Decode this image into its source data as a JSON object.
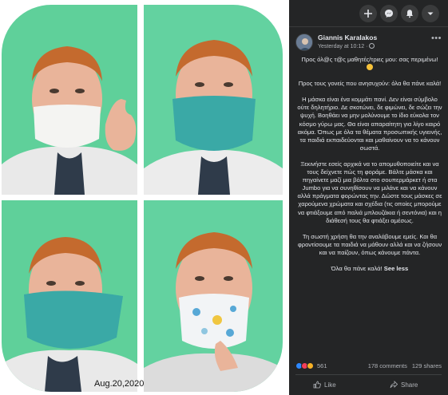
{
  "collage": {
    "date_stamp": "Aug.20,2020",
    "bg_green": "#6fd4a8",
    "mask_teal": "#3aa9a6",
    "mask_white": "#f4f4f2"
  },
  "topbar": {
    "icons": [
      "plus-icon",
      "messenger-icon",
      "bell-icon",
      "chevron-down-icon"
    ]
  },
  "post": {
    "author": "Giannis Karalakos",
    "time": "Yesterday at 10:12 ·",
    "paragraphs": [
      "Προς όλ@ς τ@ς μαθητές/τριες μου: σας περιμένω!",
      "Προς τους γονείς που ανησυχούν: όλα θα πάνε καλά!",
      "Η μάσκα είναι ένα κομμάτι πανί. Δεν είναι σύμβολο ούτε δηλητήριο. Δε σκοτώνει, δε φιμώνει, δε σώζει την ψυχή. Βοηθάει να μην μολύνουμε το ίδιο εύκολα τον κόσμο γύρω μας. Θα είναι απαραίτητη για λίγο καιρό ακόμα. Όπως με όλα τα θέματα προσωπικής υγιεινής, τα παιδιά εκπαιδεύονται και μαθαίνουν να το κάνουν σωστά.",
      "Ξεκινήστε εσείς αρχικά να το απομυθοποιείτε και να τους δείχνετε πώς τη φοράμε. Βάλτε μάσκα και πηγαίνετε μαζί μια βόλτα στο σουπερμάρκετ ή στα Jumbo για να συνηθίσουν να μιλάνε και να κάνουν αλλά πράγματα φορώντας την. Δώστε τους μάσκες σε χαρούμενα χρώματα και σχέδια (τις οποίες μπορούμε να φτιάξουμε από παλιά μπλουζάκια ή σεντόνια) και η διάθεσή τους θα φτιάξει αμέσως.",
      "Τη σωστή χρήση θα την αναλάβουμε εμείς. Και θα φροντίσουμε τα παιδιά να μάθουν αλλά και να ζήσουν και να παίζουν, όπως κάνουμε πάντα.",
      "Όλα θα πάνε καλά!"
    ],
    "see_less": "See less",
    "reactions_count": "561",
    "comments": "178 comments",
    "shares": "129 shares",
    "like_label": "Like",
    "share_label": "Share"
  }
}
